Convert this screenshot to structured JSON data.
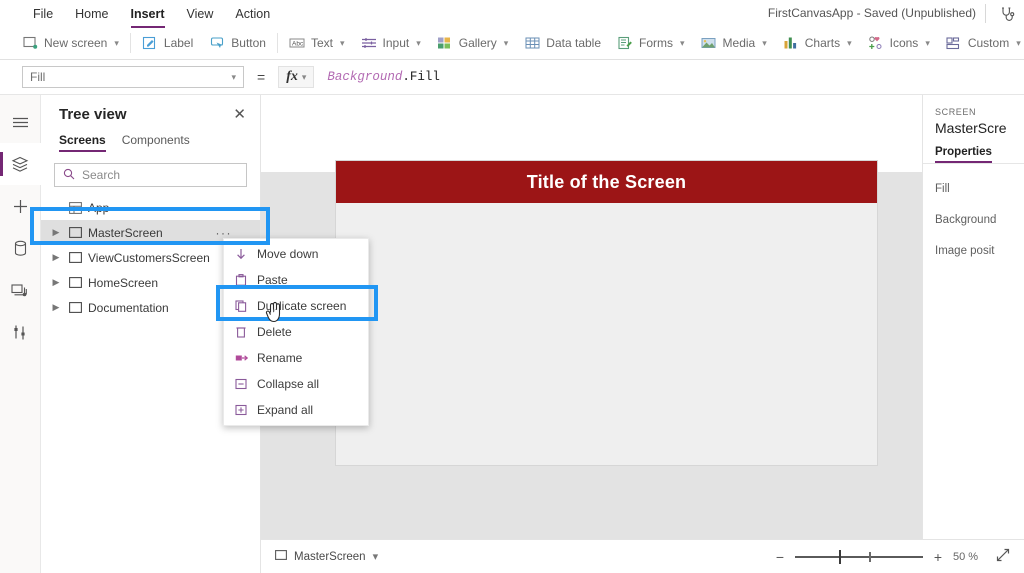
{
  "menubar": {
    "items": [
      {
        "label": "File",
        "active": false
      },
      {
        "label": "Home",
        "active": false
      },
      {
        "label": "Insert",
        "active": true
      },
      {
        "label": "View",
        "active": false
      },
      {
        "label": "Action",
        "active": false
      }
    ],
    "app_status": "FirstCanvasApp - Saved (Unpublished)",
    "checker_icon": "stethoscope-icon"
  },
  "ribbon": {
    "groups": [
      {
        "label": "New screen",
        "icon": "new-screen-icon",
        "caret": true
      },
      {
        "sep": true
      },
      {
        "label": "Label",
        "icon": "label-icon",
        "caret": false
      },
      {
        "label": "Button",
        "icon": "button-icon",
        "caret": false
      },
      {
        "sep": true
      },
      {
        "label": "Text",
        "icon": "text-icon",
        "caret": true
      },
      {
        "label": "Input",
        "icon": "input-icon",
        "caret": true
      },
      {
        "label": "Gallery",
        "icon": "gallery-icon",
        "caret": true
      },
      {
        "label": "Data table",
        "icon": "data-table-icon",
        "caret": false
      },
      {
        "label": "Forms",
        "icon": "forms-icon",
        "caret": true
      },
      {
        "label": "Media",
        "icon": "media-icon",
        "caret": true
      },
      {
        "label": "Charts",
        "icon": "charts-icon",
        "caret": true
      },
      {
        "label": "Icons",
        "icon": "icons-icon",
        "caret": true
      },
      {
        "label": "Custom",
        "icon": "custom-icon",
        "caret": true
      }
    ]
  },
  "formula_bar": {
    "property_selected": "Fill",
    "equals": "=",
    "fx_label": "fx",
    "formula_object": "Background",
    "formula_property": ".Fill"
  },
  "rail": {
    "items": [
      {
        "name": "hamburger-menu-icon",
        "active": false
      },
      {
        "name": "tree-view-icon",
        "active": true
      },
      {
        "name": "insert-add-icon",
        "active": false
      },
      {
        "name": "data-sources-icon",
        "active": false
      },
      {
        "name": "media-library-icon",
        "active": false
      },
      {
        "name": "variables-icon",
        "active": false
      }
    ]
  },
  "tree_view": {
    "title": "Tree view",
    "close_label": "✕",
    "tabs": [
      {
        "label": "Screens",
        "active": true
      },
      {
        "label": "Components",
        "active": false
      }
    ],
    "search_placeholder": "Search",
    "items": [
      {
        "label": "App",
        "icon": "app-icon",
        "chevron": false,
        "selected": false,
        "dots": false
      },
      {
        "label": "MasterScreen",
        "icon": "screen-icon",
        "chevron": true,
        "selected": true,
        "dots": "···"
      },
      {
        "label": "ViewCustomersScreen",
        "icon": "screen-icon",
        "chevron": true,
        "selected": false,
        "dots": false
      },
      {
        "label": "HomeScreen",
        "icon": "screen-icon",
        "chevron": true,
        "selected": false,
        "dots": false
      },
      {
        "label": "Documentation",
        "icon": "screen-icon",
        "chevron": true,
        "selected": false,
        "dots": false
      }
    ]
  },
  "context_menu": {
    "items": [
      {
        "label": "Move down",
        "icon": "move-down-icon",
        "highlighted": false
      },
      {
        "label": "Paste",
        "icon": "paste-icon",
        "highlighted": false
      },
      {
        "label": "Duplicate screen",
        "icon": "duplicate-icon",
        "highlighted": true
      },
      {
        "label": "Delete",
        "icon": "delete-icon",
        "highlighted": false
      },
      {
        "label": "Rename",
        "icon": "rename-icon",
        "highlighted": false
      },
      {
        "label": "Collapse all",
        "icon": "collapse-all-icon",
        "highlighted": false
      },
      {
        "label": "Expand all",
        "icon": "expand-all-icon",
        "highlighted": false
      }
    ]
  },
  "canvas": {
    "screen_title": "Title of the Screen",
    "title_fill": "#9C1516",
    "screen_fill": "#EFEFEF"
  },
  "right_panel": {
    "kind": "SCREEN",
    "name": "MasterScre",
    "tabs": [
      {
        "label": "Properties",
        "active": true
      }
    ],
    "fields": [
      "Fill",
      "Background",
      "Image posit"
    ]
  },
  "status_bar": {
    "screen_name": "MasterScreen",
    "screen_caret": "⌄",
    "zoom_out": "−",
    "zoom_in": "+",
    "zoom_value": "50 %",
    "fit_icon": "fit-to-screen-icon"
  },
  "annotations": {
    "accent": "#2196F3",
    "boxes": [
      {
        "name": "masterscreen-row-highlight"
      },
      {
        "name": "duplicate-screen-highlight"
      }
    ]
  }
}
